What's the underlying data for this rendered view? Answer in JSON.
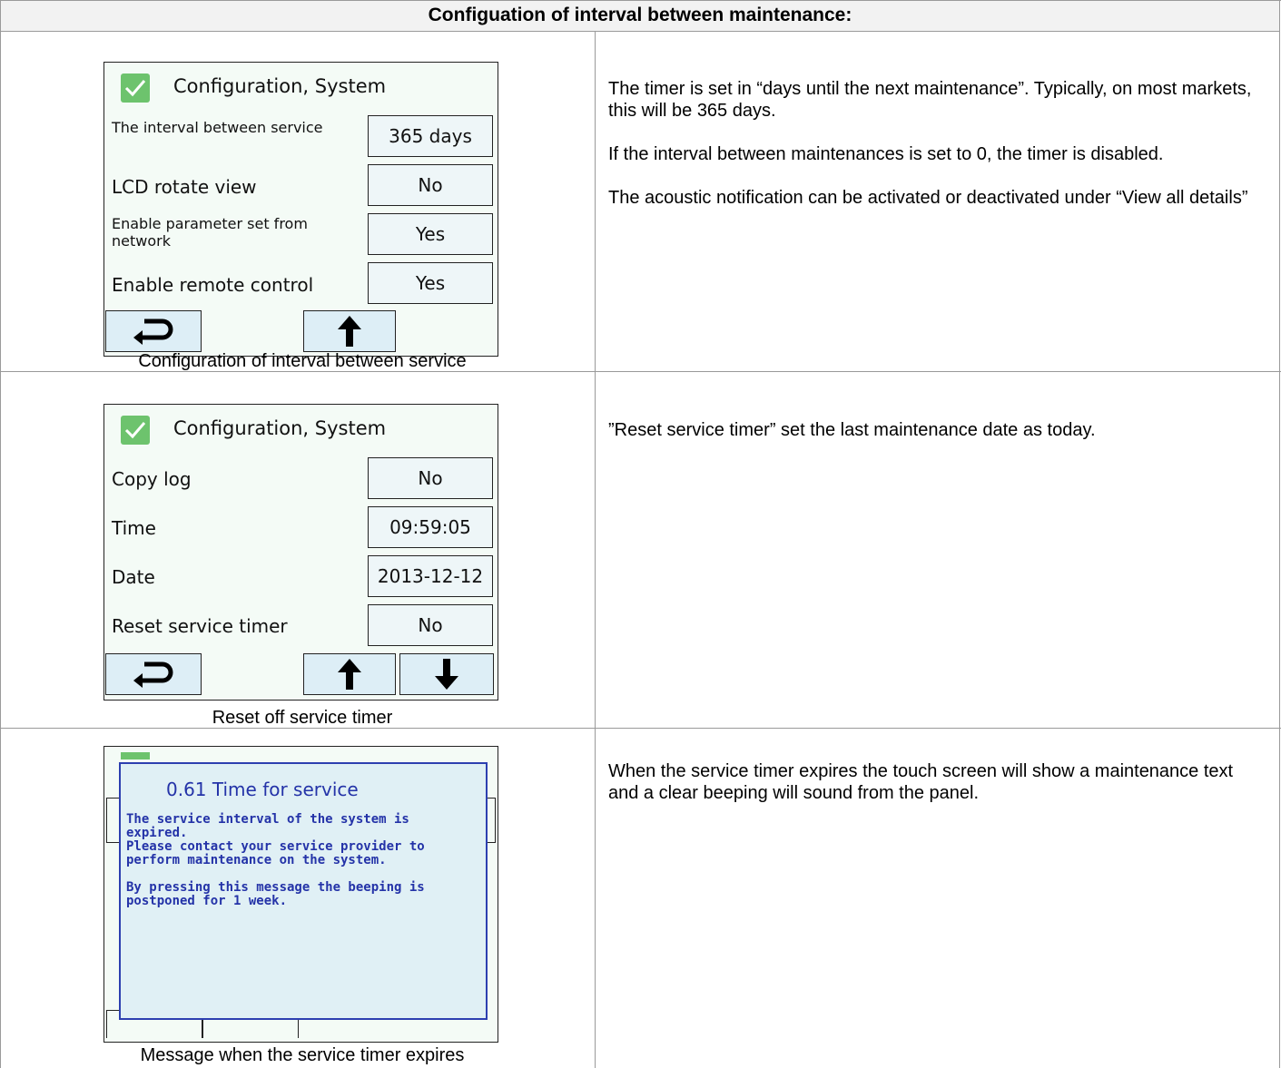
{
  "header": {
    "title": "Configuation of interval between maintenance:"
  },
  "rows": [
    {
      "screen": {
        "title": "Configuration, System",
        "items": [
          {
            "label": "The interval between service",
            "value": "365 days"
          },
          {
            "label": "LCD rotate view",
            "value": "No"
          },
          {
            "label": "Enable parameter set from network",
            "value": "Yes"
          },
          {
            "label": "Enable remote control",
            "value": "Yes"
          }
        ],
        "nav": [
          "back-icon",
          "arrow-up-icon"
        ]
      },
      "caption": "Configuration of interval between service",
      "description": [
        "The timer is set in “days until the next maintenance”. Typically, on most markets, this will be 365 days.",
        "If the interval between maintenances is set to 0, the timer is disabled.",
        "The acoustic notification can be activated or deactivated under “View all details”"
      ]
    },
    {
      "screen": {
        "title": "Configuration, System",
        "items": [
          {
            "label": "Copy log",
            "value": "No"
          },
          {
            "label": "Time",
            "value": "09:59:05"
          },
          {
            "label": "Date",
            "value": "2013-12-12"
          },
          {
            "label": "Reset service timer",
            "value": "No"
          }
        ],
        "nav": [
          "back-icon",
          "arrow-up-icon",
          "arrow-down-icon"
        ]
      },
      "caption": "Reset off service timer",
      "description": [
        "”Reset service timer” set the last maintenance date as today."
      ]
    },
    {
      "popup": {
        "title": "0.61 Time for service",
        "paragraphs": [
          "The service interval of the system is\nexpired.\nPlease contact your service provider to\nperform maintenance on the system.",
          "By pressing this message the beeping is\npostponed for 1 week."
        ]
      },
      "caption": "Message when the service timer expires",
      "description": [
        "When the service timer expires the touch screen will show a maintenance text and a clear beeping will sound from the panel."
      ]
    }
  ],
  "colors": {
    "check_green": "#6dc36d",
    "popup_blue": "#2433a8",
    "header_bg": "#f2f2f2"
  }
}
